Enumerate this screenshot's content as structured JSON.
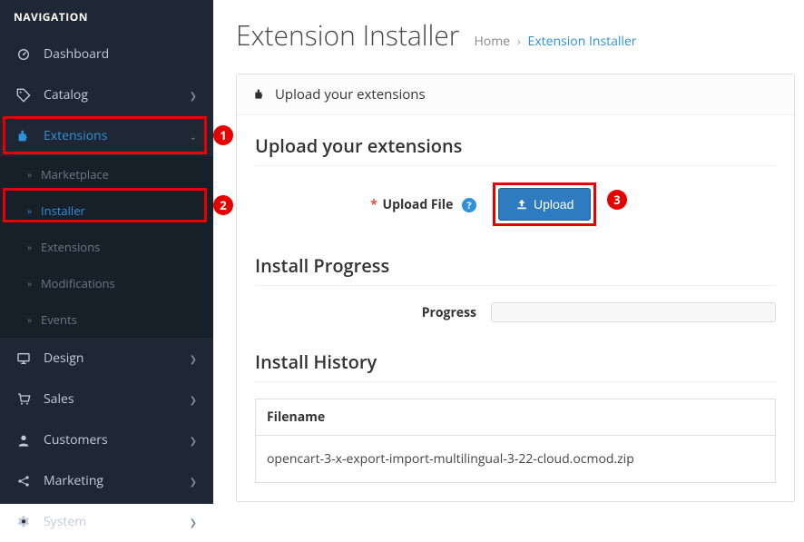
{
  "sidebar": {
    "header": "NAVIGATION",
    "items": {
      "dashboard": "Dashboard",
      "catalog": "Catalog",
      "extensions": "Extensions",
      "marketplace": "Marketplace",
      "installer": "Installer",
      "extensions_sub": "Extensions",
      "modifications": "Modifications",
      "events": "Events",
      "design": "Design",
      "sales": "Sales",
      "customers": "Customers",
      "marketing": "Marketing",
      "system": "System"
    }
  },
  "page": {
    "title": "Extension Installer",
    "breadcrumb_home": "Home",
    "breadcrumb_current": "Extension Installer"
  },
  "panel": {
    "heading": "Upload your extensions"
  },
  "upload": {
    "section_title": "Upload your extensions",
    "label": "Upload File",
    "button": "Upload"
  },
  "progress": {
    "section_title": "Install Progress",
    "label": "Progress"
  },
  "history": {
    "section_title": "Install History",
    "col_filename": "Filename",
    "rows": [
      {
        "filename": "opencart-3-x-export-import-multilingual-3-22-cloud.ocmod.zip"
      }
    ]
  },
  "annotations": {
    "one": "1",
    "two": "2",
    "three": "3"
  }
}
